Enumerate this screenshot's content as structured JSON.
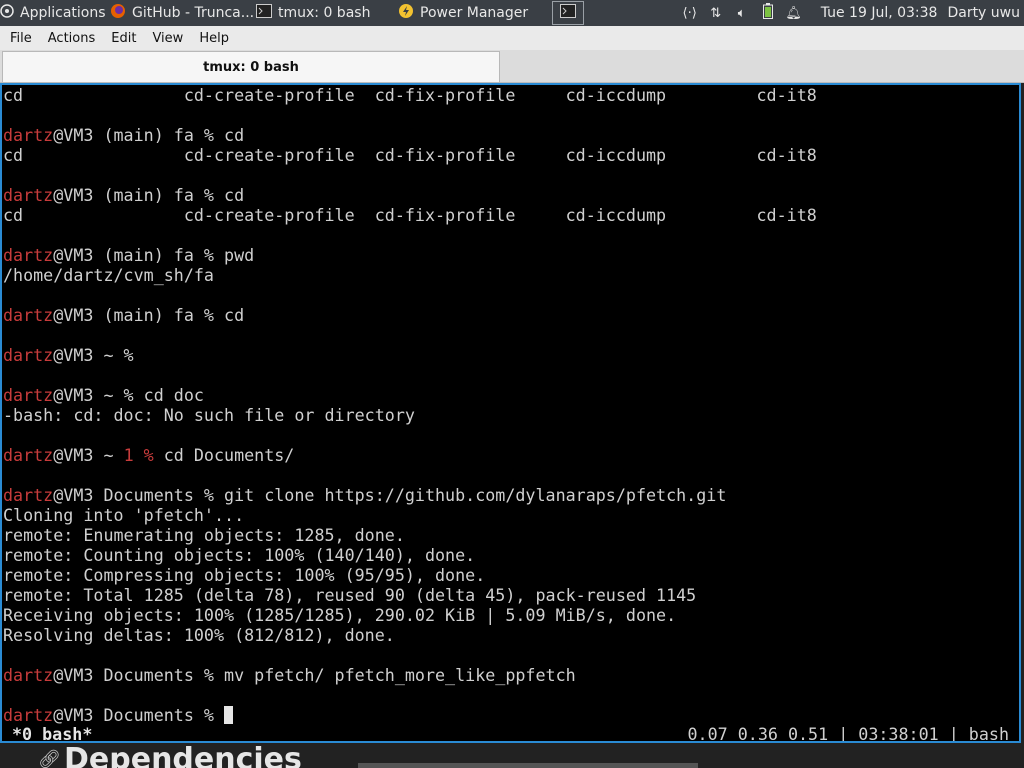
{
  "panel": {
    "applications": "Applications",
    "tasks": [
      {
        "label": "GitHub - Trunca...",
        "icon": "firefox-icon"
      },
      {
        "label": "tmux: 0 bash",
        "icon": "terminal-icon"
      },
      {
        "label": "Power Manager",
        "icon": "power-icon"
      }
    ],
    "clock": "Tue 19 Jul, 03:38",
    "user": "Darty uwu"
  },
  "menubar": [
    "File",
    "Actions",
    "Edit",
    "View",
    "Help"
  ],
  "tab": {
    "title": "tmux: 0 bash"
  },
  "terminal": {
    "colors": {
      "user": "#c83c3c",
      "text": "#d0d0d0",
      "border": "#2a8bd4"
    },
    "lines": [
      {
        "plain": "cd                cd-create-profile  cd-fix-profile     cd-iccdump         cd-it8"
      },
      {
        "plain": ""
      },
      {
        "user": "dartz",
        "rest": "@VM3 (main) fa % cd"
      },
      {
        "plain": "cd                cd-create-profile  cd-fix-profile     cd-iccdump         cd-it8"
      },
      {
        "plain": ""
      },
      {
        "user": "dartz",
        "rest": "@VM3 (main) fa % cd"
      },
      {
        "plain": "cd                cd-create-profile  cd-fix-profile     cd-iccdump         cd-it8"
      },
      {
        "plain": ""
      },
      {
        "user": "dartz",
        "rest": "@VM3 (main) fa % pwd"
      },
      {
        "plain": "/home/dartz/cvm_sh/fa"
      },
      {
        "plain": ""
      },
      {
        "user": "dartz",
        "rest": "@VM3 (main) fa % cd"
      },
      {
        "plain": ""
      },
      {
        "user": "dartz",
        "rest": "@VM3 ~ %"
      },
      {
        "plain": ""
      },
      {
        "user": "dartz",
        "rest": "@VM3 ~ % cd doc"
      },
      {
        "plain": "-bash: cd: doc: No such file or directory"
      },
      {
        "plain": ""
      },
      {
        "user": "dartz",
        "rest": "@VM3 ~ ",
        "err": "1 %",
        "rest2": " cd Documents/"
      },
      {
        "plain": ""
      },
      {
        "user": "dartz",
        "rest": "@VM3 Documents % git clone https://github.com/dylanaraps/pfetch.git"
      },
      {
        "plain": "Cloning into 'pfetch'..."
      },
      {
        "plain": "remote: Enumerating objects: 1285, done."
      },
      {
        "plain": "remote: Counting objects: 100% (140/140), done."
      },
      {
        "plain": "remote: Compressing objects: 100% (95/95), done."
      },
      {
        "plain": "remote: Total 1285 (delta 78), reused 90 (delta 45), pack-reused 1145"
      },
      {
        "plain": "Receiving objects: 100% (1285/1285), 290.02 KiB | 5.09 MiB/s, done."
      },
      {
        "plain": "Resolving deltas: 100% (812/812), done."
      },
      {
        "plain": ""
      },
      {
        "user": "dartz",
        "rest": "@VM3 Documents % mv pfetch/ pfetch_more_like_ppfetch"
      },
      {
        "plain": ""
      },
      {
        "user": "dartz",
        "rest": "@VM3 Documents % ",
        "cursor": true
      }
    ]
  },
  "status": {
    "left": "*0 bash*",
    "right": "0.07 0.36 0.51 | 03:38:01 | bash"
  },
  "behind": {
    "title": "Dependencies"
  }
}
